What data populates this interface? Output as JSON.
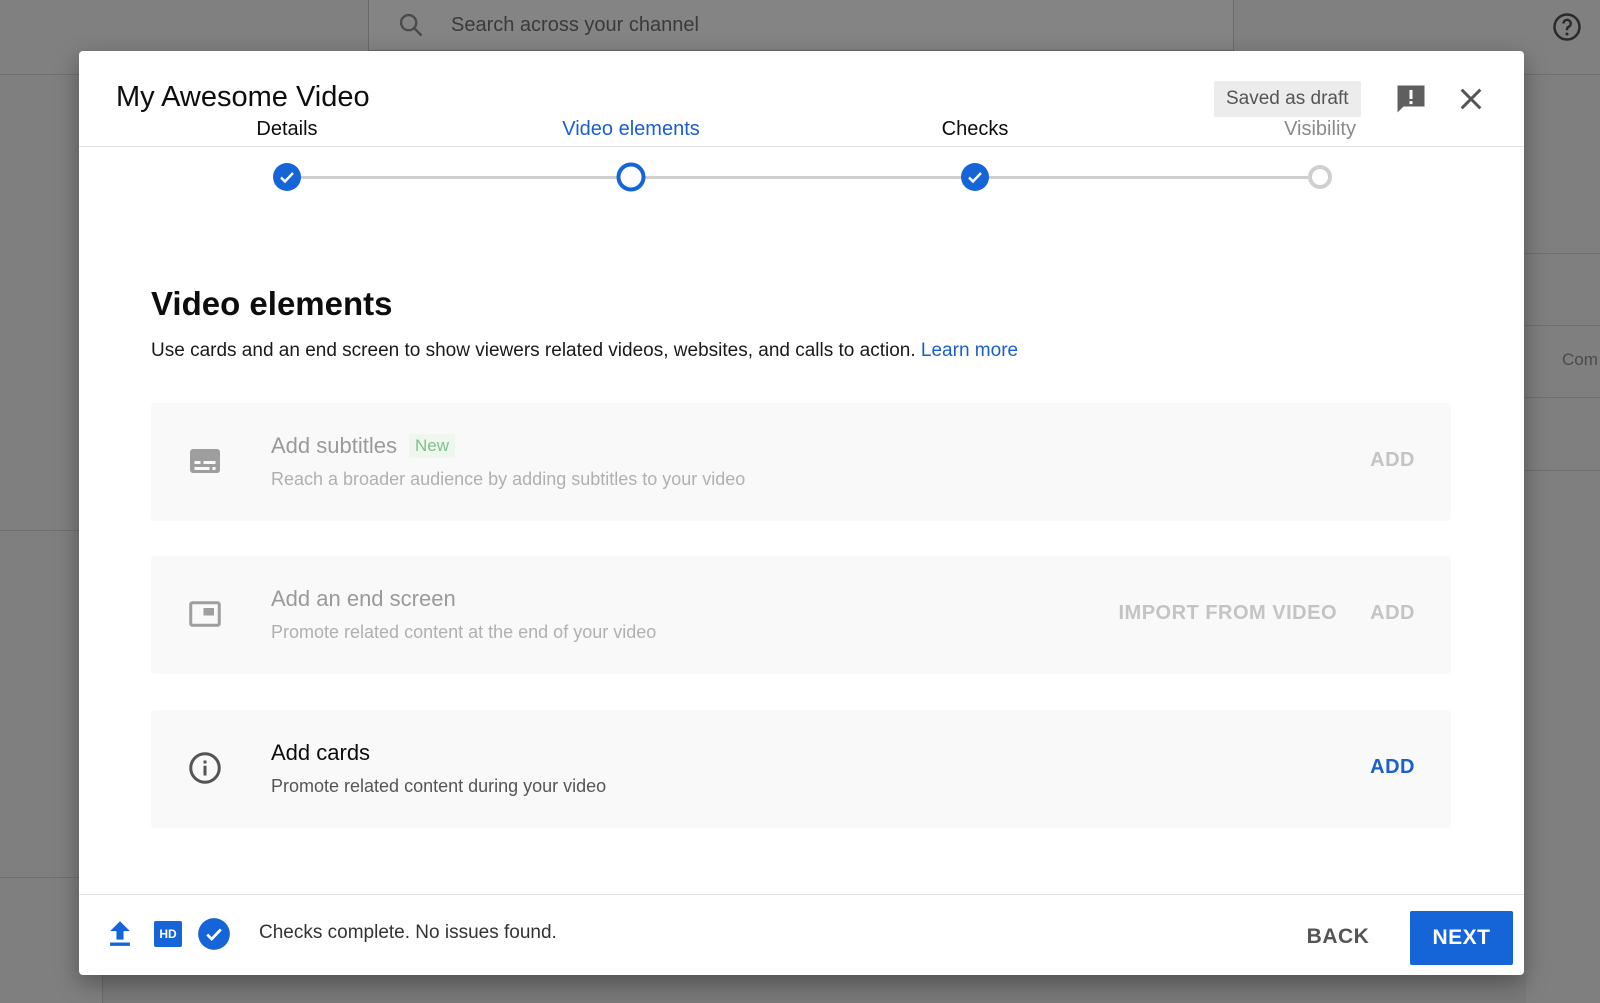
{
  "background": {
    "search_placeholder": "Search across your channel",
    "right_partial_text": "Com"
  },
  "dialog": {
    "title": "My Awesome Video",
    "draft_status": "Saved as draft"
  },
  "stepper": {
    "steps": [
      {
        "label": "Details",
        "state": "completed"
      },
      {
        "label": "Video elements",
        "state": "current"
      },
      {
        "label": "Checks",
        "state": "completed"
      },
      {
        "label": "Visibility",
        "state": "upcoming"
      }
    ]
  },
  "section": {
    "title": "Video elements",
    "description": "Use cards and an end screen to show viewers related videos, websites, and calls to action.",
    "learn_more": "Learn more"
  },
  "cards": [
    {
      "title": "Add subtitles",
      "badge": "New",
      "subtitle": "Reach a broader audience by adding subtitles to your video",
      "add_label": "ADD",
      "enabled": false,
      "icon": "subtitles-icon"
    },
    {
      "title": "Add an end screen",
      "subtitle": "Promote related content at the end of your video",
      "import_label": "IMPORT FROM VIDEO",
      "add_label": "ADD",
      "enabled": false,
      "icon": "end-screen-icon"
    },
    {
      "title": "Add cards",
      "subtitle": "Promote related content during your video",
      "add_label": "ADD",
      "enabled": true,
      "icon": "info-icon"
    }
  ],
  "footer": {
    "status_text": "Checks complete. No issues found.",
    "hd_label": "HD",
    "back_label": "BACK",
    "next_label": "NEXT"
  },
  "colors": {
    "accent": "#1565d8",
    "link": "#1a5fd0",
    "inactive_step": "#cfcfcf",
    "overlay": "#7f7f7f"
  }
}
